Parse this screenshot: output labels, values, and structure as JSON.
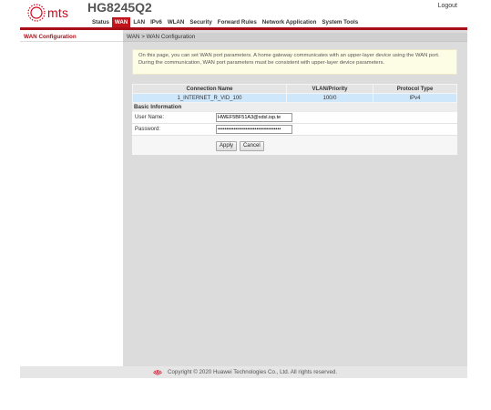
{
  "brand": {
    "logo_text": "mts",
    "model": "HG8245Q2",
    "logout": "Logout"
  },
  "nav": {
    "items": [
      "Status",
      "WAN",
      "LAN",
      "IPv6",
      "WLAN",
      "Security",
      "Forward Rules",
      "Network Application",
      "System Tools"
    ],
    "active": "WAN"
  },
  "sidebar": {
    "items": [
      "WAN Configuration"
    ]
  },
  "breadcrumb": "WAN > WAN Configuration",
  "info_text": "On this page, you can set WAN port parameters. A home gateway communicates with an upper-layer device using the WAN port. During the communication, WAN port parameters must be consistent with upper-layer device parameters.",
  "table": {
    "headers": [
      "Connection Name",
      "VLAN/Priority",
      "Protocol Type"
    ],
    "rows": [
      [
        "1_INTERNET_R_VID_100",
        "100/0",
        "IPv4"
      ]
    ]
  },
  "basic": {
    "title": "Basic Information",
    "username_label": "User Name:",
    "username_value": "HWEF5BF51A3@xdsl.isp.te",
    "password_label": "Password:",
    "password_value": "••••••••••••••••••••••••••••••••••••"
  },
  "buttons": {
    "apply": "Apply",
    "cancel": "Cancel"
  },
  "footer": {
    "copyright": "Copyright © 2020 Huawei Technologies Co., Ltd. All rights reserved."
  },
  "colors": {
    "brand_red": "#c0141d",
    "selected_row": "#cfe7fb"
  }
}
